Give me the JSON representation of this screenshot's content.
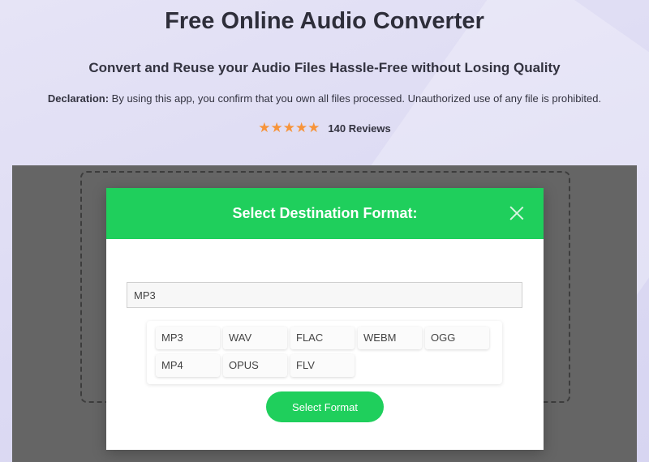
{
  "header": {
    "title": "Free Online Audio Converter",
    "subtitle": "Convert and Reuse your Audio Files Hassle-Free without Losing Quality",
    "declaration_label": "Declaration:",
    "declaration_text": " By using this app, you confirm that you own all files processed. Unauthorized use of any file is prohibited.",
    "stars": "★★★★★",
    "rating": 5,
    "reviews": "140 Reviews"
  },
  "modal": {
    "title": "Select Destination Format:",
    "input_value": "MP3",
    "options": [
      "MP3",
      "WAV",
      "FLAC",
      "WEBM",
      "OGG",
      "MP4",
      "OPUS",
      "FLV"
    ],
    "select_label": "Select Format"
  },
  "colors": {
    "accent": "#1fcf5c",
    "star": "#f7943a",
    "overlay": "#656565"
  },
  "icons": {
    "close": "close-icon",
    "star": "star-icon"
  }
}
